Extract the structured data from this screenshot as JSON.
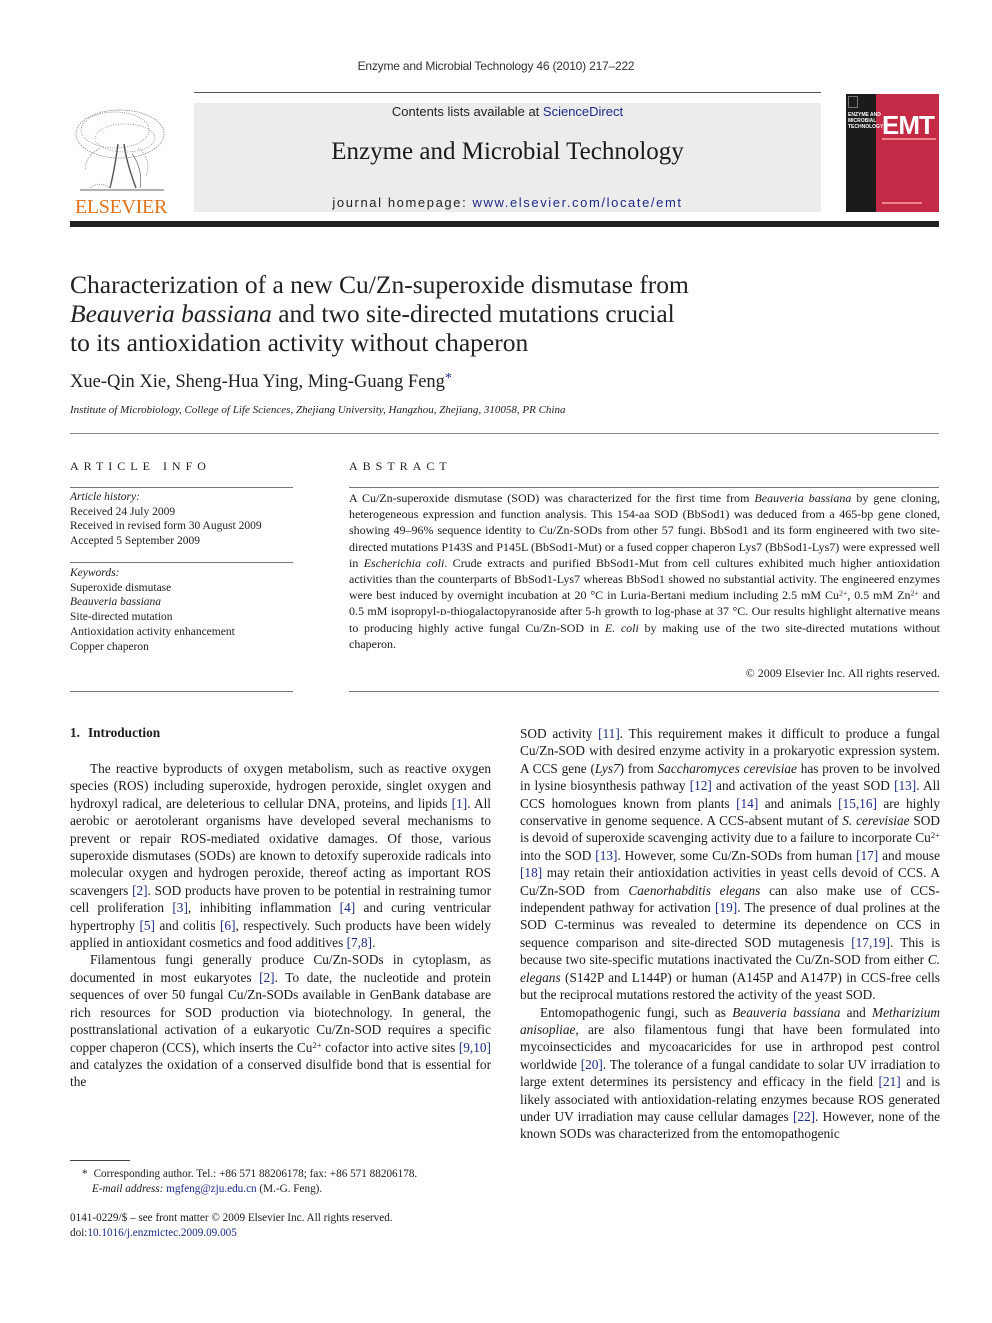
{
  "running_header": "Enzyme and Microbial Technology 46 (2010) 217–222",
  "masthead": {
    "contents_prefix": "Contents lists available at ",
    "contents_link": "ScienceDirect",
    "journal_title": "Enzyme and Microbial Technology",
    "homepage_prefix": "journal homepage: ",
    "homepage_link": "www.elsevier.com/locate/emt",
    "publisher_logo_text": "ELSEVIER",
    "cover": {
      "journal_small": "ENZYME AND MICROBIAL TECHNOLOGY",
      "acronym": "EMT"
    },
    "colors": {
      "publisher_orange": "#e2731a",
      "link_blue": "#1d2a86",
      "cover_red": "#c42a45",
      "masthead_gray": "#ececec"
    }
  },
  "article": {
    "title_line1": "Characterization of a new Cu/Zn-superoxide dismutase from",
    "title_line2_italic": "Beauveria bassiana",
    "title_line2_rest": " and two site-directed mutations crucial",
    "title_line3": "to its antioxidation activity without chaperon",
    "authors": "Xue-Qin Xie, Sheng-Hua Ying, Ming-Guang Feng",
    "corresponding_mark": "*",
    "affiliation": "Institute of Microbiology, College of Life Sciences, Zhejiang University, Hangzhou, Zhejiang, 310058, PR China"
  },
  "article_info": {
    "heading": "ARTICLE INFO",
    "history_label": "Article history:",
    "history": [
      "Received 24 July 2009",
      "Received in revised form 30 August 2009",
      "Accepted 5 September 2009"
    ],
    "keywords_label": "Keywords:",
    "keywords": [
      "Superoxide dismutase",
      "Beauveria bassiana",
      "Site-directed mutation",
      "Antioxidation activity enhancement",
      "Copper chaperon"
    ]
  },
  "abstract": {
    "heading": "ABSTRACT",
    "s1a": "A Cu/Zn-superoxide dismutase (SOD) was characterized for the first time from ",
    "s1_species": "Beauveria bassiana",
    "s1b": " by gene cloning, heterogeneous expression and function analysis. This 154-aa SOD (BbSod1) was deduced from a 465-bp gene cloned, showing 49–96% sequence identity to Cu/Zn-SODs from other 57 fungi. BbSod1 and its form engineered with two site-directed mutations P143S and P145L (BbSod1-Mut) or a fused copper chaperon Lys7 (BbSod1-Lys7) were expressed well in ",
    "s1_host": "Escherichia coli",
    "s2": ". Crude extracts and purified BbSod1-Mut from cell cultures exhibited much higher antioxidation activities than the counterparts of BbSod1-Lys7 whereas BbSod1 showed no substantial activity. The engineered enzymes were best induced by overnight incubation at 20 °C in Luria-Bertani medium including 2.5 mM Cu",
    "sup1": "2+",
    "s3": ", 0.5 mM Zn",
    "sup2": "2+",
    "s4": " and 0.5 mM isopropyl-ᴅ-thiogalactopyranoside after 5-h growth to log-phase at 37 °C. Our results highlight alternative means to producing highly active fungal Cu/Zn-SOD in ",
    "s4_host": "E. coli",
    "s5": " by making use of the two site-directed mutations without chaperon.",
    "copyright": "© 2009 Elsevier Inc. All rights reserved."
  },
  "introduction": {
    "heading_number": "1.",
    "heading_title": "Introduction",
    "p1": {
      "a": "The reactive byproducts of oxygen metabolism, such as reactive oxygen species (ROS) including superoxide, hydrogen peroxide, singlet oxygen and hydroxyl radical, are deleterious to cellular DNA, proteins, and lipids ",
      "r1": "[1]",
      "b": ". All aerobic or aerotolerant organisms have developed several mechanisms to prevent or repair ROS-mediated oxidative damages. Of those, various superoxide dismutases (SODs) are known to detoxify superoxide radicals into molecular oxygen and hydrogen peroxide, thereof acting as important ROS scavengers ",
      "r2": "[2]",
      "c": ". SOD products have proven to be potential in restraining tumor cell proliferation ",
      "r3": "[3]",
      "d": ", inhibiting inflammation ",
      "r4": "[4]",
      "e": " and curing ventricular hypertrophy ",
      "r5": "[5]",
      "f": " and colitis ",
      "r6": "[6]",
      "g": ", respectively. Such products have been widely applied in antioxidant cosmetics and food additives ",
      "r7": "[7,8]",
      "h": "."
    },
    "p2": {
      "a": "Filamentous fungi generally produce Cu/Zn-SODs in cytoplasm, as documented in most eukaryotes ",
      "r1": "[2]",
      "b": ". To date, the nucleotide and protein sequences of over 50 fungal Cu/Zn-SODs available in GenBank database are rich resources for SOD production via biotechnology. In general, the posttranslational activation of a eukaryotic Cu/Zn-SOD requires a specific copper chaperon (CCS), which inserts the Cu",
      "sup": "2+",
      "c": " cofactor into active sites ",
      "r2": "[9,10]",
      "d": " and catalyzes the oxidation of a conserved disulfide bond that is essential for the SOD activity ",
      "r3": "[11]",
      "e": ". This requirement makes it difficult to produce a fungal Cu/Zn-SOD with desired enzyme activity in a prokaryotic expression system. A CCS gene (",
      "gene": "Lys7",
      "f": ") from ",
      "species1": "Saccharomyces cerevisiae",
      "g": " has proven to be involved in lysine biosynthesis pathway ",
      "r4": "[12]",
      "h": " and activation of the yeast SOD ",
      "r5": "[13]",
      "i": ". All CCS homologues known from plants ",
      "r6": "[14]",
      "j": " and animals ",
      "r7": "[15,16]",
      "k": " are highly conservative in genome sequence. A CCS-absent mutant of ",
      "species2": "S. cerevisiae",
      "l": " SOD is devoid of superoxide scavenging activity due to a failure to incorporate Cu",
      "sup2": "2+",
      "m": " into the SOD ",
      "r8": "[13]",
      "n": ". However, some Cu/Zn-SODs from human ",
      "r9": "[17]",
      "o": " and mouse ",
      "r10": "[18]",
      "p": " may retain their antioxidation activities in yeast cells devoid of CCS. A Cu/Zn-SOD from ",
      "species3": "Caenorhabditis elegans",
      "q": " can also make use of CCS-independent pathway for activation ",
      "r11": "[19]",
      "r": ". The presence of dual prolines at the SOD C-terminus was revealed to determine its dependence on CCS in sequence comparison and site-directed SOD mutagenesis ",
      "r12": "[17,19]",
      "s": ". This is because two site-specific mutations inactivated the Cu/Zn-SOD from either ",
      "species4": "C. elegans",
      "t": " (S142P and L144P) or human (A145P and A147P) in CCS-free cells but the reciprocal mutations restored the activity of the yeast SOD."
    },
    "p3": {
      "a": "Entomopathogenic fungi, such as ",
      "species1": "Beauveria bassiana",
      "b": " and ",
      "species2": "Metharizium anisopliae",
      "c": ", are also filamentous fungi that have been formulated into mycoinsecticides and mycoacaricides for use in arthropod pest control worldwide ",
      "r1": "[20]",
      "d": ". The tolerance of a fungal candidate to solar UV irradiation to large extent determines its persistency and efficacy in the field ",
      "r2": "[21]",
      "e": " and is likely associated with antioxidation-relating enzymes because ROS generated under UV irradiation may cause cellular damages ",
      "r3": "[22]",
      "f": ". However, none of the known SODs was characterized from the entomopathogenic"
    }
  },
  "footnote": {
    "mark": "*",
    "corresponding": "Corresponding author. Tel.: +86 571 88206178; fax: +86 571 88206178.",
    "email_label": "E-mail address: ",
    "email": "mgfeng@zju.edu.cn",
    "email_suffix": " (M.-G. Feng)."
  },
  "front_matter": {
    "issn_line": "0141-0229/$ – see front matter © 2009 Elsevier Inc. All rights reserved.",
    "doi_prefix": "doi:",
    "doi": "10.1016/j.enzmictec.2009.09.005"
  }
}
